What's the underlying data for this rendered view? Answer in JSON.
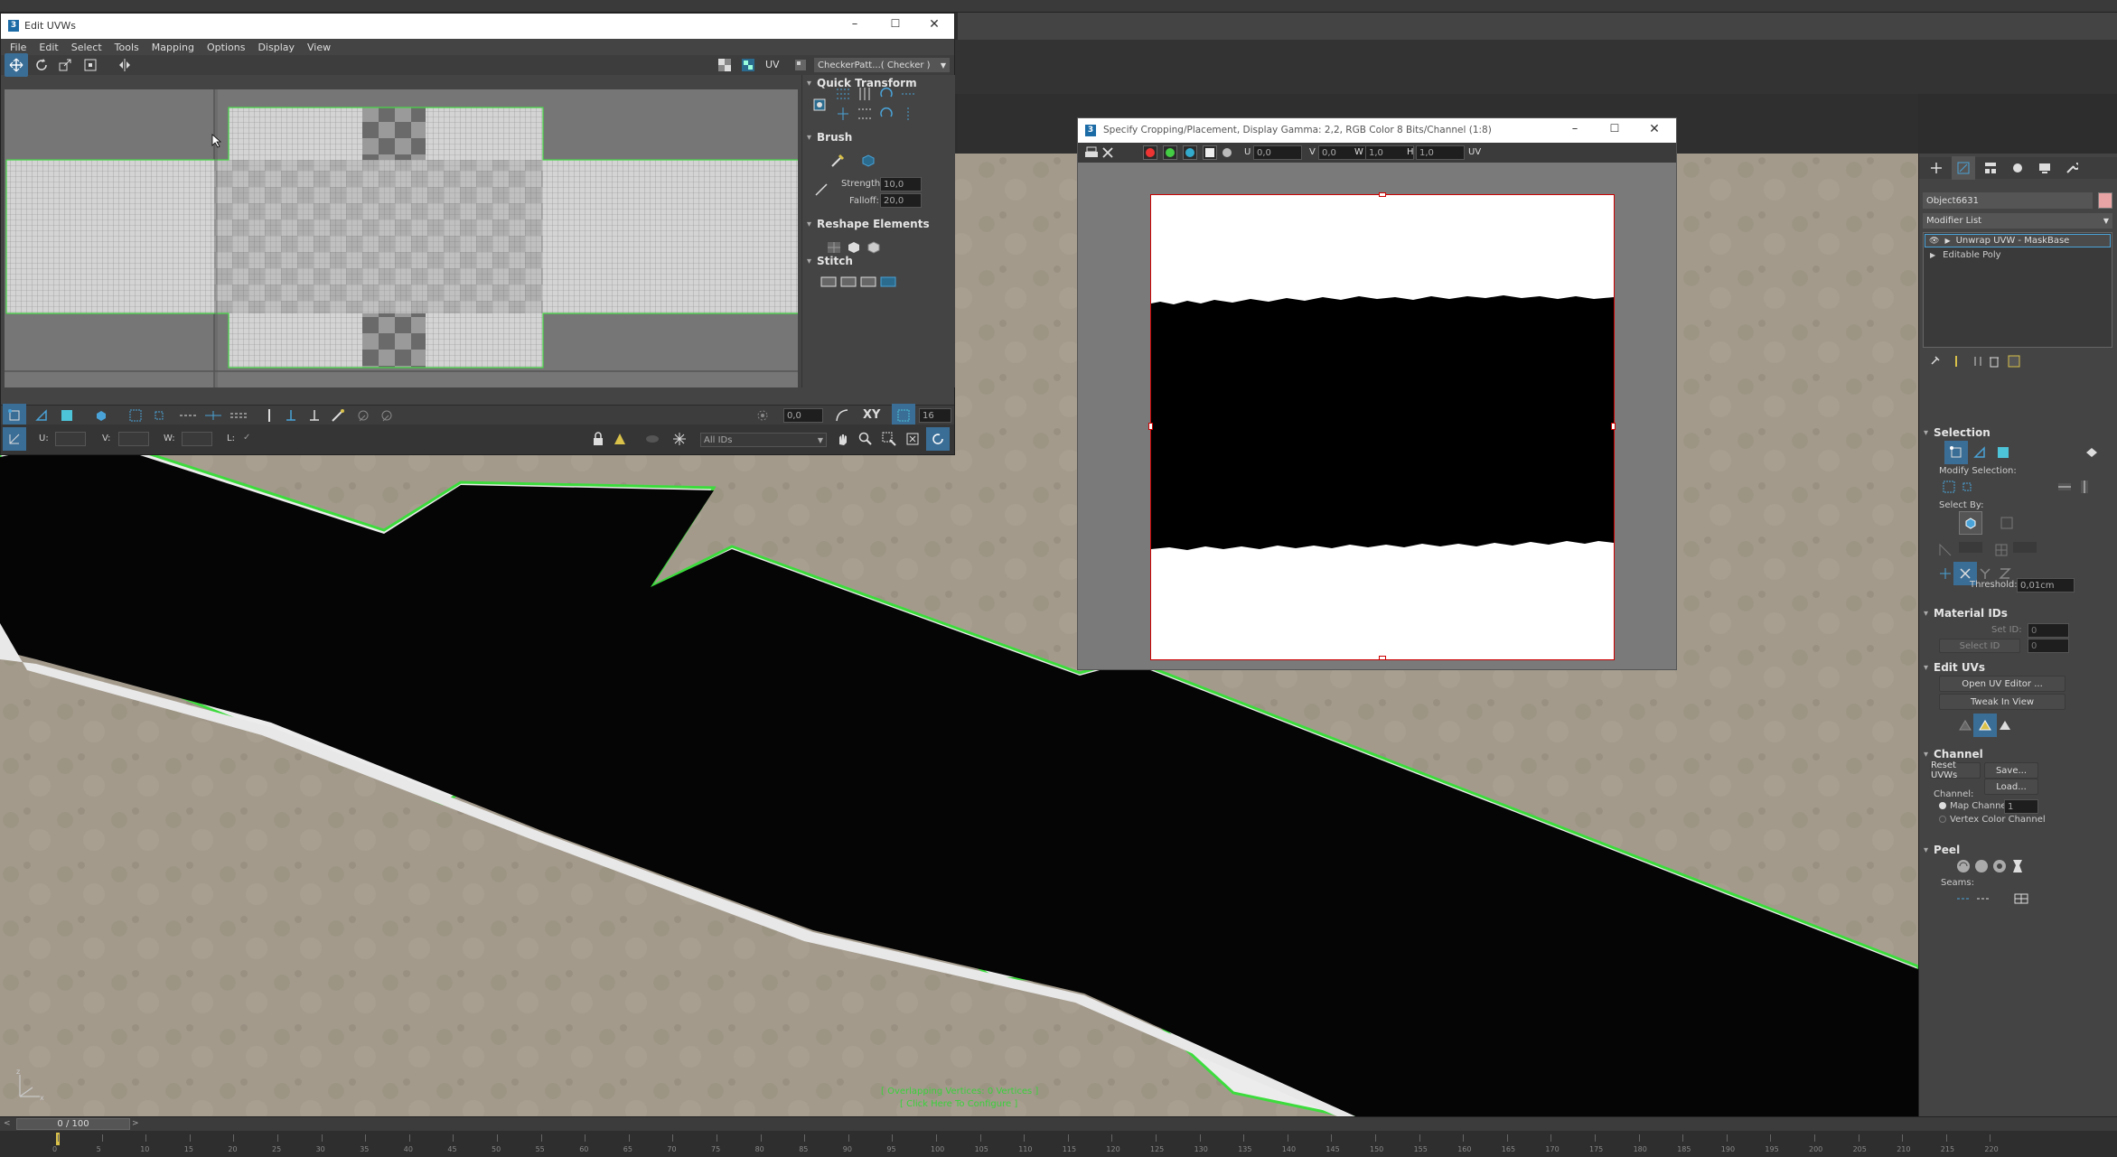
{
  "uvw": {
    "title": "Edit UVWs",
    "menu": [
      "File",
      "Edit",
      "Select",
      "Tools",
      "Mapping",
      "Options",
      "Display",
      "View"
    ],
    "uv_label": "UV",
    "map_dropdown": "CheckerPatt...( Checker )",
    "panels": {
      "quick_transform": "Quick Transform",
      "brush": "Brush",
      "strength_label": "Strength:",
      "strength_value": "10,0",
      "falloff_label": "Falloff:",
      "falloff_value": "20,0",
      "reshape": "Reshape Elements",
      "stitch": "Stitch"
    },
    "bottom": {
      "rotate_value": "0,0",
      "xy_label": "XY",
      "grid_value": "16",
      "u_label": "U:",
      "v_label": "V:",
      "w_label": "W:",
      "l_label": "L:",
      "ids_value": "All IDs"
    }
  },
  "crop": {
    "title": "Specify Cropping/Placement, Display Gamma: 2,2, RGB Color 8 Bits/Channel (1:8)",
    "u_label": "U",
    "u_value": "0,0",
    "v_label": "V",
    "v_value": "0,0",
    "w_label": "W",
    "w_value": "1,0",
    "h_label": "H",
    "h_value": "1,0",
    "uv_label": "UV"
  },
  "viewport": {
    "overlap_text": "[ Overlapping Vertices: 0 Vertices ]",
    "configure_text": "[ Click Here To Configure ]"
  },
  "cmd": {
    "object_name": "Object6631",
    "modifier_list": "Modifier List",
    "stack": [
      "Unwrap UVW - MaskBase",
      "Editable Poly"
    ],
    "selection": {
      "title": "Selection",
      "modify_selection": "Modify Selection:",
      "select_by": "Select By:",
      "threshold_label": "Threshold:",
      "threshold_value": "0,01cm"
    },
    "material_ids": {
      "title": "Material IDs",
      "set_id": "Set ID:",
      "set_id_value": "0",
      "select_id": "Select ID",
      "select_id_value": "0"
    },
    "edit_uvs": {
      "title": "Edit UVs",
      "open_editor": "Open UV Editor ...",
      "tweak": "Tweak In View"
    },
    "channel": {
      "title": "Channel",
      "reset": "Reset UVWs",
      "save": "Save...",
      "load": "Load...",
      "channel_label": "Channel:",
      "map_channel": "Map Channel:",
      "map_channel_value": "1",
      "vertex_color": "Vertex Color Channel"
    },
    "peel": {
      "title": "Peel",
      "seams": "Seams:"
    }
  },
  "timeline": {
    "frame_display": "0 / 100",
    "ticks": [
      "0",
      "5",
      "10",
      "15",
      "20",
      "25",
      "30",
      "35",
      "40",
      "45",
      "50",
      "55",
      "60",
      "65",
      "70",
      "75",
      "80",
      "85",
      "90",
      "95",
      "100",
      "105",
      "110",
      "115",
      "120",
      "125",
      "130",
      "135",
      "140",
      "145",
      "150",
      "155",
      "160",
      "165",
      "170",
      "175",
      "180",
      "185",
      "190",
      "195",
      "200",
      "205",
      "210",
      "215",
      "220"
    ]
  },
  "colors": {
    "accent": "#4aa3d8",
    "green_outline": "#39d23a",
    "panel_bg": "#444444",
    "viewport_bg": "#a39a8c"
  }
}
